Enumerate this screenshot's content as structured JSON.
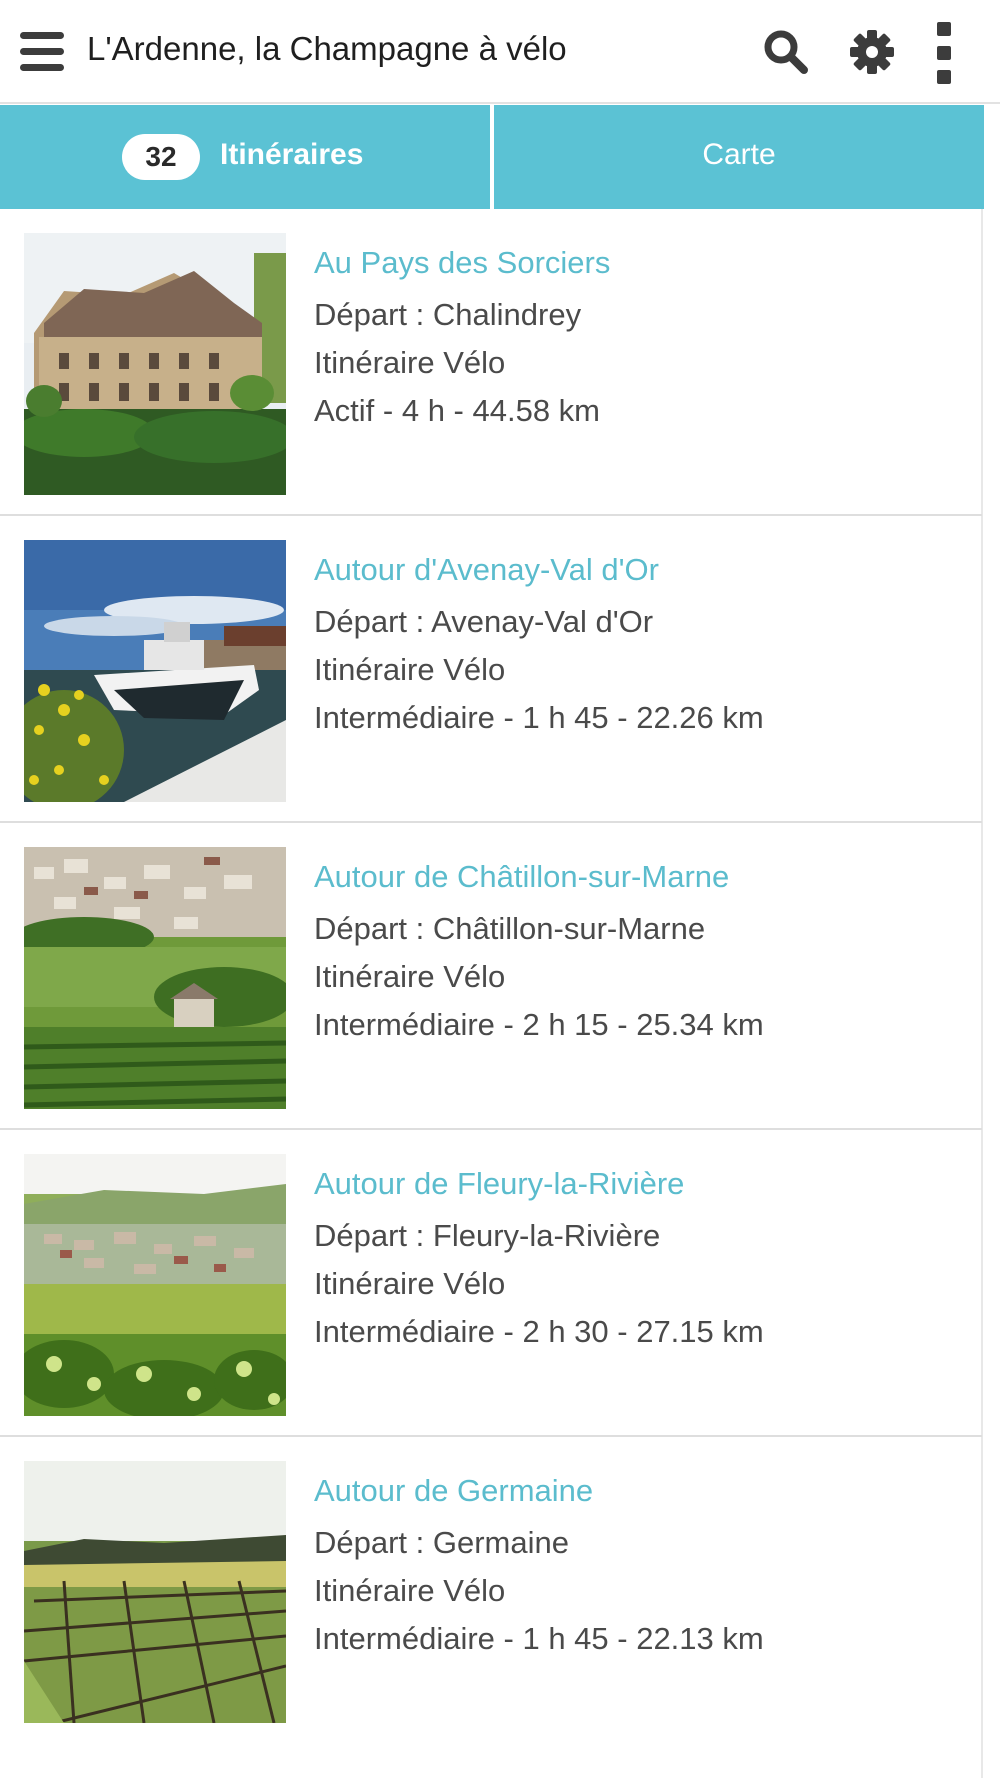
{
  "app": {
    "title": "L'Ardenne, la Champagne à vélo",
    "accent_color": "#5bc2d4",
    "icons": [
      "menu-icon",
      "search-icon",
      "gear-icon",
      "more-vert-icon"
    ]
  },
  "tabs": {
    "count": "32",
    "itineraries_label": "Itinéraires",
    "map_label": "Carte",
    "active": "Itinéraires"
  },
  "items": [
    {
      "title": "Au Pays des Sorciers",
      "departure": "Départ : Chalindrey",
      "type": "Itinéraire Vélo",
      "details": "Actif - 4 h - 44.58 km",
      "image": "chateau-photo"
    },
    {
      "title": "Autour d'Avenay-Val d'Or",
      "departure": "Départ : Avenay-Val d'Or",
      "type": "Itinéraire Vélo",
      "details": "Intermédiaire - 1 h 45 - 22.26 km",
      "image": "canal-boat-photo"
    },
    {
      "title": "Autour de Châtillon-sur-Marne",
      "departure": "Départ : Châtillon-sur-Marne",
      "type": "Itinéraire Vélo",
      "details": "Intermédiaire - 2 h 15 - 25.34 km",
      "image": "village-vineyard-photo"
    },
    {
      "title": "Autour de Fleury-la-Rivière",
      "departure": "Départ : Fleury-la-Rivière",
      "type": "Itinéraire Vélo",
      "details": "Intermédiaire - 2 h 30 - 27.15 km",
      "image": "valley-village-photo"
    },
    {
      "title": "Autour de Germaine",
      "departure": "Départ : Germaine",
      "type": "Itinéraire Vélo",
      "details": "Intermédiaire - 1 h 45 - 22.13 km",
      "image": "vine-rows-photo"
    }
  ]
}
